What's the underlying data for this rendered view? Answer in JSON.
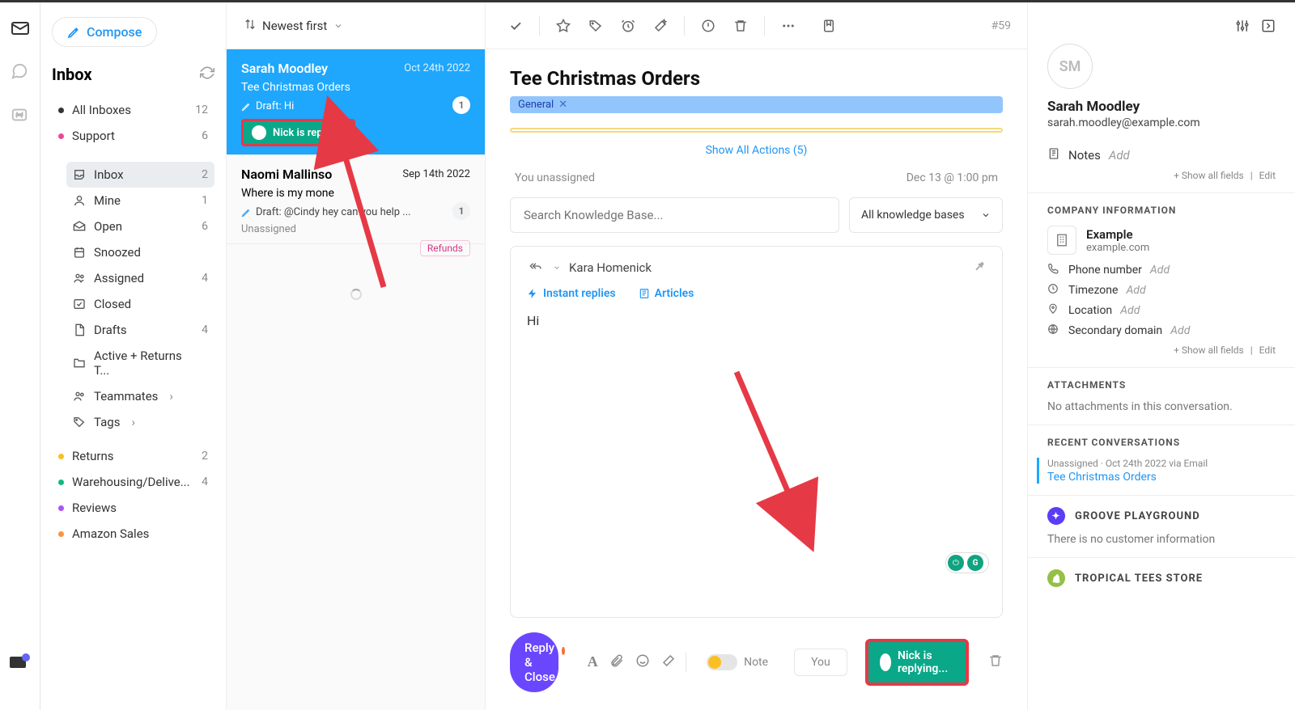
{
  "rail": {
    "status_indicator": true
  },
  "compose": {
    "label": "Compose"
  },
  "inbox": {
    "title": "Inbox",
    "all_inboxes": {
      "label": "All Inboxes",
      "count": "12"
    },
    "support": {
      "label": "Support",
      "count": "6",
      "items": [
        {
          "icon": "inbox",
          "label": "Inbox",
          "count": "2",
          "active": true
        },
        {
          "icon": "user",
          "label": "Mine",
          "count": "1"
        },
        {
          "icon": "open",
          "label": "Open",
          "count": "6"
        },
        {
          "icon": "clock",
          "label": "Snoozed",
          "count": ""
        },
        {
          "icon": "users",
          "label": "Assigned",
          "count": "4"
        },
        {
          "icon": "check",
          "label": "Closed",
          "count": ""
        },
        {
          "icon": "file",
          "label": "Drafts",
          "count": "4"
        },
        {
          "icon": "folder",
          "label": "Active + Returns T...",
          "count": ""
        },
        {
          "icon": "team",
          "label": "Teammates",
          "count": "",
          "chevron": true
        },
        {
          "icon": "tag",
          "label": "Tags",
          "count": "",
          "chevron": true
        }
      ]
    },
    "other_mailboxes": [
      {
        "dot": "#fbbf24",
        "label": "Returns",
        "count": "2"
      },
      {
        "dot": "#10b981",
        "label": "Warehousing/Delive...",
        "count": "4"
      },
      {
        "dot": "#a855f7",
        "label": "Reviews",
        "count": ""
      },
      {
        "dot": "#fb923c",
        "label": "Amazon Sales",
        "count": ""
      }
    ]
  },
  "list": {
    "sort": "Newest first",
    "conversations": [
      {
        "from": "Sarah Moodley",
        "date": "Oct 24th 2022",
        "subject": "Tee Christmas Orders",
        "draft": "Draft: Hi",
        "badge": "1",
        "replying": "Nick is replying",
        "selected": true
      },
      {
        "from": "Naomi Mallinso",
        "date": "Sep 14th 2022",
        "subject": "Where is my mone",
        "draft": "Draft: @Cindy hey can you help ...",
        "badge": "1",
        "status": "Unassigned",
        "tag": "Refunds"
      }
    ]
  },
  "conversation": {
    "number": "#59",
    "title": "Tee Christmas Orders",
    "tag": "General",
    "show_actions": "Show All Actions (5)",
    "meta_left": "You unassigned",
    "meta_right": "Dec 13 @ 1:00 pm",
    "kb_placeholder": "Search Knowledge Base...",
    "kb_select": "All knowledge bases",
    "to": "Kara Homenick",
    "instant_replies": "Instant replies",
    "articles": "Articles",
    "body": "Hi",
    "reply_btn": "Reply & Close",
    "note_label": "Note",
    "you_btn": "You",
    "replying_badge": "Nick is replying..."
  },
  "contact": {
    "initials": "SM",
    "name": "Sarah Moodley",
    "email": "sarah.moodley@example.com",
    "notes_label": "Notes",
    "add": "Add",
    "show_all_fields": "+ Show all fields",
    "edit": "Edit",
    "company_section": "COMPANY INFORMATION",
    "company_name": "Example",
    "company_domain": "example.com",
    "fields": [
      {
        "icon": "phone",
        "label": "Phone number",
        "add": true
      },
      {
        "icon": "clock",
        "label": "Timezone",
        "add": true
      },
      {
        "icon": "pin",
        "label": "Location",
        "add": true
      },
      {
        "icon": "globe",
        "label": "Secondary domain",
        "add": true
      }
    ],
    "attachments_section": "ATTACHMENTS",
    "attachments_empty": "No attachments in this conversation.",
    "recent_section": "RECENT CONVERSATIONS",
    "recent_meta": "Unassigned · Oct 24th 2022 via Email",
    "recent_title": "Tee Christmas Orders",
    "groove_section": "GROOVE PLAYGROUND",
    "groove_empty": "There is no customer information",
    "shopify_section": "TROPICAL TEES STORE"
  }
}
